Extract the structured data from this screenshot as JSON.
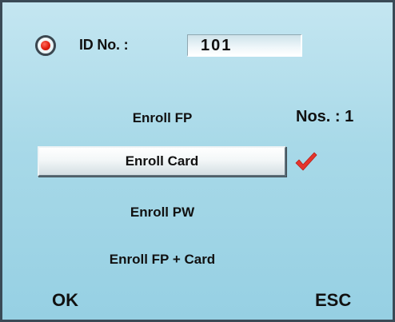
{
  "id_row": {
    "label": "ID No. :",
    "value": "101"
  },
  "menu": {
    "items": [
      {
        "label": "Enroll FP"
      },
      {
        "label": "Enroll Card"
      },
      {
        "label": "Enroll PW"
      },
      {
        "label": "Enroll FP + Card"
      }
    ],
    "selected_index": 1
  },
  "count_text": "Nos. : 1",
  "softkeys": {
    "ok": "OK",
    "esc": "ESC"
  },
  "colors": {
    "background": "#a8d9e8",
    "radio_dot": "#e01e10",
    "checkmark": "#e5352d"
  },
  "icons": {
    "radio": "radio-selected-icon",
    "check": "checkmark-icon"
  }
}
